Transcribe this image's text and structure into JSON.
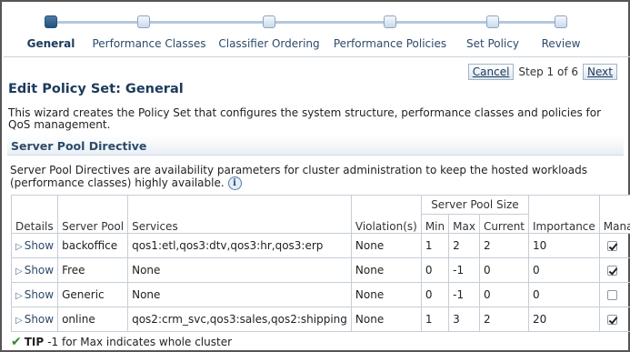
{
  "train": {
    "steps": [
      {
        "label": "General",
        "active": true
      },
      {
        "label": "Performance Classes",
        "active": false
      },
      {
        "label": "Classifier Ordering",
        "active": false
      },
      {
        "label": "Performance Policies",
        "active": false
      },
      {
        "label": "Set Policy",
        "active": false
      },
      {
        "label": "Review",
        "active": false
      }
    ]
  },
  "nav": {
    "cancel_label": "Cancel",
    "step_text": "Step 1 of 6",
    "next_label": "Next"
  },
  "page": {
    "title": "Edit Policy Set: General",
    "description": "This wizard creates the Policy Set that configures the system structure, performance classes and policies for QoS management."
  },
  "section": {
    "title": "Server Pool Directive",
    "description": "Server Pool Directives are availability parameters for cluster administration to keep the hosted workloads (performance classes) highly available.",
    "info_icon_glyph": "i"
  },
  "table": {
    "headers": {
      "details": "Details",
      "server_pool": "Server Pool",
      "services": "Services",
      "violations": "Violation(s)",
      "server_pool_size": "Server Pool Size",
      "min": "Min",
      "max": "Max",
      "current": "Current",
      "importance": "Importance",
      "manage": "Manage"
    },
    "show_label": "Show",
    "rows": [
      {
        "server_pool": "backoffice",
        "services": "qos1:etl,qos3:dtv,qos3:hr,qos3:erp",
        "violations": "None",
        "min": "1",
        "max": "2",
        "current": "2",
        "importance": "10",
        "manage": true
      },
      {
        "server_pool": "Free",
        "services": "None",
        "violations": "None",
        "min": "0",
        "max": "-1",
        "current": "0",
        "importance": "0",
        "manage": true
      },
      {
        "server_pool": "Generic",
        "services": "None",
        "violations": "None",
        "min": "0",
        "max": "-1",
        "current": "0",
        "importance": "0",
        "manage": false
      },
      {
        "server_pool": "online",
        "services": "qos2:crm_svc,qos3:sales,qos2:shipping",
        "violations": "None",
        "min": "1",
        "max": "3",
        "current": "2",
        "importance": "20",
        "manage": true
      }
    ]
  },
  "tip": {
    "label": "TIP",
    "text": "-1 for Max indicates whole cluster"
  },
  "colors": {
    "accent": "#23507e",
    "title": "#1c3a5c",
    "tip_check": "#2e8b2e"
  }
}
